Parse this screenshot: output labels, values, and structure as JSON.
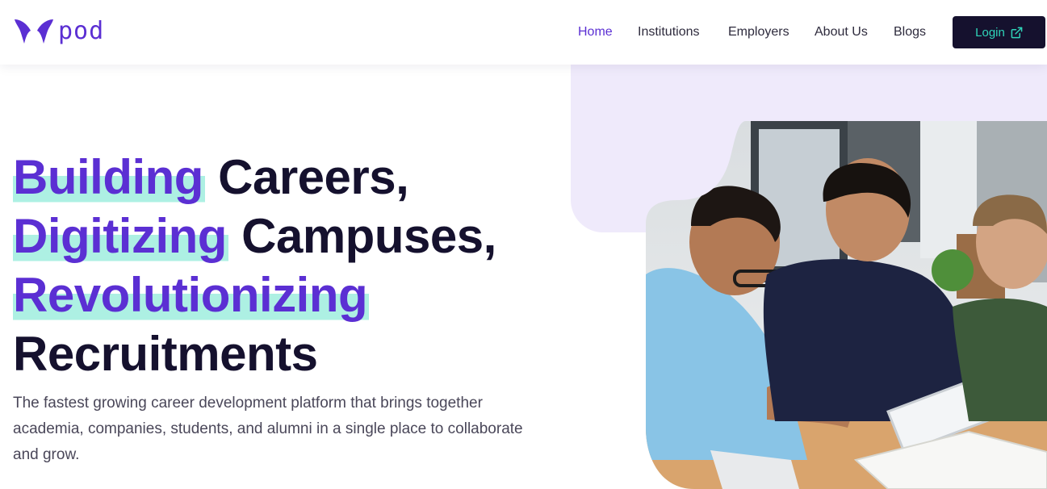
{
  "brand": {
    "name": "pod",
    "logo_icon": "pod-logo-icon",
    "accent_color": "#5b2fd3",
    "highlight_color": "#adf0e3",
    "dark_color": "#15112e",
    "teal_color": "#2fd4b9"
  },
  "nav": {
    "items": [
      {
        "label": "Home",
        "active": true
      },
      {
        "label": "Institutions",
        "active": false
      },
      {
        "label": "Employers",
        "active": false
      },
      {
        "label": "About Us",
        "active": false
      },
      {
        "label": "Blogs",
        "active": false
      }
    ],
    "login_label": "Login",
    "login_icon": "external-link-icon"
  },
  "hero": {
    "lines": [
      {
        "highlight": "Building",
        "rest": "Careers,"
      },
      {
        "highlight": "Digitizing",
        "rest": "Campuses,"
      },
      {
        "highlight": "Revolutionizing",
        "rest": ""
      },
      {
        "highlight": "",
        "rest": "Recruitments"
      }
    ],
    "subtitle": "The fastest growing career development platform that brings together academia, companies, students, and alumni in a single place to collaborate and grow.",
    "image_alt": "students-collaborating-photo"
  }
}
